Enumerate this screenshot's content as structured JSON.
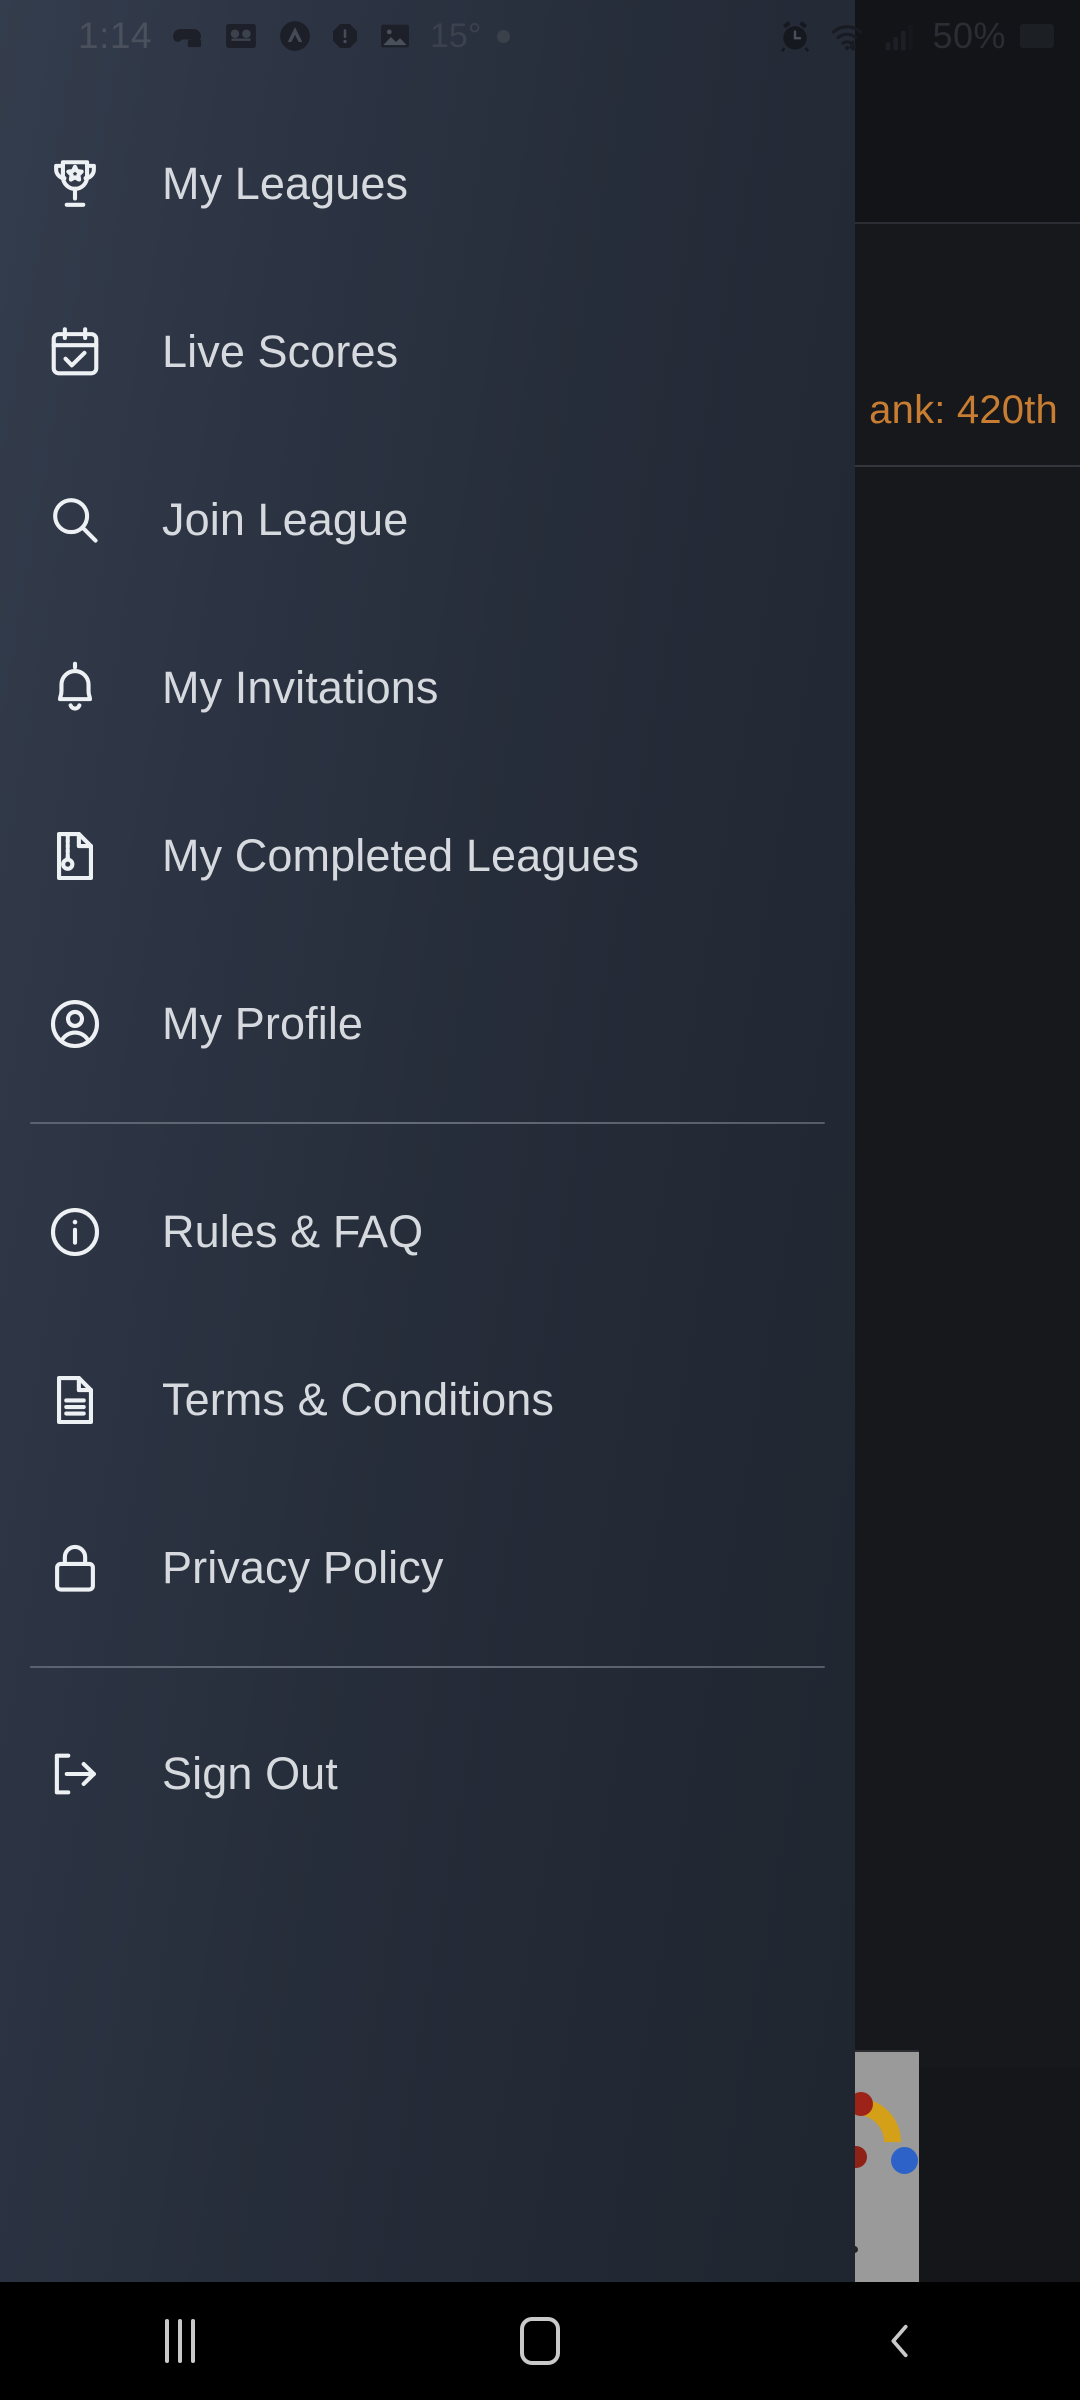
{
  "status_bar": {
    "time": "1:14",
    "temperature": "15°",
    "battery_percent": "50%",
    "left_icons": [
      "game-controller-icon",
      "voicemail-icon",
      "triangle-a-icon",
      "alert-octagon-icon",
      "image-icon"
    ],
    "right_icons": [
      "alarm-clock-icon",
      "wifi-icon",
      "signal-bars-icon",
      "battery-icon"
    ]
  },
  "drawer": {
    "primary_items": [
      {
        "label": "My Leagues",
        "icon": "trophy-icon"
      },
      {
        "label": "Live Scores",
        "icon": "calendar-check-icon"
      },
      {
        "label": "Join League",
        "icon": "search-icon"
      },
      {
        "label": "My Invitations",
        "icon": "bell-icon"
      },
      {
        "label": "My Completed Leagues",
        "icon": "archive-file-icon"
      },
      {
        "label": "My Profile",
        "icon": "user-circle-icon"
      }
    ],
    "secondary_items": [
      {
        "label": "Rules & FAQ",
        "icon": "info-circle-icon"
      },
      {
        "label": "Terms & Conditions",
        "icon": "document-text-icon"
      },
      {
        "label": "Privacy Policy",
        "icon": "lock-icon"
      }
    ],
    "footer_items": [
      {
        "label": "Sign Out",
        "icon": "logout-icon"
      }
    ]
  },
  "background_app": {
    "rank_text": "ank: 420th",
    "rank_color": "#c87d33"
  },
  "navigation_bar": {
    "recents_label": "Recents",
    "home_label": "Home",
    "back_label": "Back"
  },
  "theme": {
    "drawer_bg_light": "#343d4d",
    "drawer_bg_dark": "#20262f",
    "text_color": "#d6dade",
    "icon_color": "#eef1f4",
    "scrim_color": "#17191c",
    "accent_orange": "#c87d33"
  }
}
